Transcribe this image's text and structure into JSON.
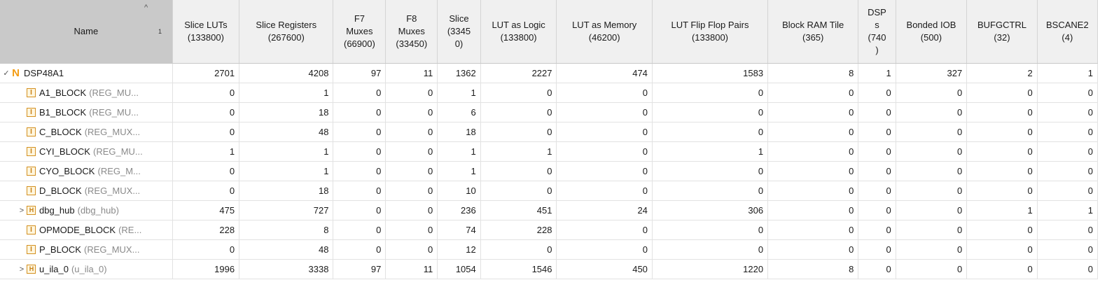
{
  "columns": [
    {
      "key": "name",
      "lines": [
        "Name"
      ]
    },
    {
      "key": "slice_luts",
      "lines": [
        "Slice LUTs",
        "(133800)"
      ]
    },
    {
      "key": "slice_registers",
      "lines": [
        "Slice Registers",
        "(267600)"
      ]
    },
    {
      "key": "f7_muxes",
      "lines": [
        "F7",
        "Muxes",
        "(66900)"
      ]
    },
    {
      "key": "f8_muxes",
      "lines": [
        "F8",
        "Muxes",
        "(33450)"
      ]
    },
    {
      "key": "slice",
      "lines": [
        "Slice",
        "(3345",
        "0)"
      ]
    },
    {
      "key": "lut_as_logic",
      "lines": [
        "LUT as Logic",
        "(133800)"
      ]
    },
    {
      "key": "lut_as_memory",
      "lines": [
        "LUT as Memory",
        "(46200)"
      ]
    },
    {
      "key": "lut_ff_pairs",
      "lines": [
        "LUT Flip Flop Pairs",
        "(133800)"
      ]
    },
    {
      "key": "bram_tile",
      "lines": [
        "Block RAM Tile",
        "(365)"
      ]
    },
    {
      "key": "dsps",
      "lines": [
        "DSP",
        "s",
        "(740",
        ")"
      ]
    },
    {
      "key": "bonded_iob",
      "lines": [
        "Bonded IOB",
        "(500)"
      ]
    },
    {
      "key": "bufgctrl",
      "lines": [
        "BUFGCTRL",
        "(32)"
      ]
    },
    {
      "key": "bscane2",
      "lines": [
        "BSCANE2",
        "(4)"
      ]
    }
  ],
  "sort": {
    "arrow": "^",
    "index": "1"
  },
  "rows": [
    {
      "expander": "✓",
      "icon": "N",
      "name": "DSP48A1",
      "ref": "",
      "values": [
        "2701",
        "4208",
        "97",
        "11",
        "1362",
        "2227",
        "474",
        "1583",
        "8",
        "1",
        "327",
        "2",
        "1"
      ]
    },
    {
      "expander": "",
      "icon": "I",
      "name": "A1_BLOCK",
      "ref": "(REG_MU...",
      "values": [
        "0",
        "1",
        "0",
        "0",
        "1",
        "0",
        "0",
        "0",
        "0",
        "0",
        "0",
        "0",
        "0"
      ]
    },
    {
      "expander": "",
      "icon": "I",
      "name": "B1_BLOCK",
      "ref": "(REG_MU...",
      "values": [
        "0",
        "18",
        "0",
        "0",
        "6",
        "0",
        "0",
        "0",
        "0",
        "0",
        "0",
        "0",
        "0"
      ]
    },
    {
      "expander": "",
      "icon": "I",
      "name": "C_BLOCK",
      "ref": "(REG_MUX...",
      "values": [
        "0",
        "48",
        "0",
        "0",
        "18",
        "0",
        "0",
        "0",
        "0",
        "0",
        "0",
        "0",
        "0"
      ]
    },
    {
      "expander": "",
      "icon": "I",
      "name": "CYI_BLOCK",
      "ref": "(REG_MU...",
      "values": [
        "1",
        "1",
        "0",
        "0",
        "1",
        "1",
        "0",
        "1",
        "0",
        "0",
        "0",
        "0",
        "0"
      ]
    },
    {
      "expander": "",
      "icon": "I",
      "name": "CYO_BLOCK",
      "ref": "(REG_M...",
      "values": [
        "0",
        "1",
        "0",
        "0",
        "1",
        "0",
        "0",
        "0",
        "0",
        "0",
        "0",
        "0",
        "0"
      ]
    },
    {
      "expander": "",
      "icon": "I",
      "name": "D_BLOCK",
      "ref": "(REG_MUX...",
      "values": [
        "0",
        "18",
        "0",
        "0",
        "10",
        "0",
        "0",
        "0",
        "0",
        "0",
        "0",
        "0",
        "0"
      ]
    },
    {
      "expander": ">",
      "icon": "H",
      "name": "dbg_hub",
      "ref": "(dbg_hub)",
      "values": [
        "475",
        "727",
        "0",
        "0",
        "236",
        "451",
        "24",
        "306",
        "0",
        "0",
        "0",
        "1",
        "1"
      ]
    },
    {
      "expander": "",
      "icon": "I",
      "name": "OPMODE_BLOCK",
      "ref": "(RE...",
      "values": [
        "228",
        "8",
        "0",
        "0",
        "74",
        "228",
        "0",
        "0",
        "0",
        "0",
        "0",
        "0",
        "0"
      ]
    },
    {
      "expander": "",
      "icon": "I",
      "name": "P_BLOCK",
      "ref": "(REG_MUX...",
      "values": [
        "0",
        "48",
        "0",
        "0",
        "12",
        "0",
        "0",
        "0",
        "0",
        "0",
        "0",
        "0",
        "0"
      ]
    },
    {
      "expander": ">",
      "icon": "H",
      "name": "u_ila_0",
      "ref": "(u_ila_0)",
      "values": [
        "1996",
        "3338",
        "97",
        "11",
        "1054",
        "1546",
        "450",
        "1220",
        "8",
        "0",
        "0",
        "0",
        "0"
      ]
    }
  ]
}
